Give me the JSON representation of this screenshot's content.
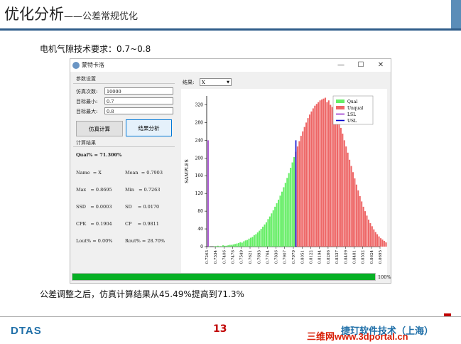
{
  "slide": {
    "title": "优化分析",
    "subtitle": "——公差常规优化",
    "requirement": "电机气隙技术要求：0.7~0.8",
    "result": "公差调整之后，仿真计算结果从45.49%提高到71.3%",
    "page_number": "13",
    "logo": "DTAS",
    "company": "捷玎软件技术（上海）",
    "watermark": "三维网www.3dportal.cn",
    "accent_color": "#2f5d8a"
  },
  "window": {
    "title": "蒙特卡洛",
    "icon": "app-icon",
    "controls": [
      "minimize-icon",
      "maximize-icon",
      "close-icon"
    ]
  },
  "params": {
    "group_label": "参数设置",
    "fields": [
      {
        "label": "仿真次数:",
        "value": "10000"
      },
      {
        "label": "目标最小:",
        "value": "0.7"
      },
      {
        "label": "目标最大:",
        "value": "0.8"
      }
    ],
    "simulate_button": "仿真计算",
    "analyze_button": "结果分析"
  },
  "results": {
    "group_label": "计算结果",
    "qual": "Qual% = 71.300%",
    "rows": [
      [
        "Name  = X",
        "Mean  = 0.7903"
      ],
      [
        "Max   = 0.8695",
        "Min   = 0.7263"
      ],
      [
        "SSD   = 0.0003",
        "SD    = 0.0170"
      ],
      [
        "CPK   = 0.1904",
        "CP    = 0.9811"
      ],
      [
        "Lout% = 0.00%",
        "Rout% = 28.70%"
      ]
    ]
  },
  "selector": {
    "label": "结果:",
    "value": "X"
  },
  "progress": {
    "value": 1.0,
    "text": "100%"
  },
  "chart_data": {
    "type": "bar",
    "ylabel": "SAMPLES",
    "xlabel": "",
    "ylim": [
      0,
      340
    ],
    "yticks": [
      0,
      40,
      80,
      120,
      160,
      200,
      240,
      280,
      320
    ],
    "xlim": [
      0.7263,
      0.8695
    ],
    "xticks": [
      "0.7263",
      "0.7334",
      "0.7406",
      "0.7478",
      "0.7549",
      "0.7621",
      "0.7693",
      "0.7764",
      "0.7836",
      "0.7907",
      "0.7979",
      "0.8051",
      "0.8122",
      "0.8194",
      "0.8266",
      "0.8337",
      "0.8409",
      "0.8481",
      "0.8552",
      "0.8624",
      "0.8695"
    ],
    "lsl": 0.7,
    "usl": 0.8,
    "lsl_height": 240,
    "usl_height": 240,
    "legend": [
      {
        "name": "Qual",
        "color": "#66ee66"
      },
      {
        "name": "Unqual",
        "color": "#ee6666"
      },
      {
        "name": "LSL",
        "color": "#9933cc"
      },
      {
        "name": "USL",
        "color": "#0000cc"
      }
    ],
    "legend_position": "top-right",
    "grid": false,
    "bin_start": 0.7263,
    "bin_width": 0.001432,
    "qual_color": "#66ee66",
    "unqual_color": "#ee6666",
    "values": [
      0,
      1,
      0,
      0,
      1,
      1,
      2,
      1,
      1,
      3,
      2,
      2,
      3,
      4,
      4,
      5,
      6,
      7,
      8,
      10,
      9,
      12,
      14,
      15,
      18,
      20,
      22,
      26,
      28,
      32,
      36,
      40,
      45,
      50,
      55,
      62,
      68,
      75,
      82,
      90,
      98,
      106,
      115,
      124,
      134,
      144,
      155,
      166,
      178,
      190,
      202,
      214,
      226,
      238,
      250,
      260,
      270,
      280,
      290,
      298,
      305,
      312,
      318,
      322,
      326,
      330,
      332,
      334,
      336,
      326,
      330,
      320,
      315,
      308,
      300,
      292,
      280,
      268,
      255,
      240,
      226,
      212,
      196,
      182,
      168,
      154,
      140,
      127,
      114,
      102,
      90,
      80,
      70,
      61,
      53,
      46,
      39,
      33,
      28,
      23,
      19,
      16,
      13,
      10,
      8,
      6,
      5,
      4,
      3,
      2
    ]
  }
}
